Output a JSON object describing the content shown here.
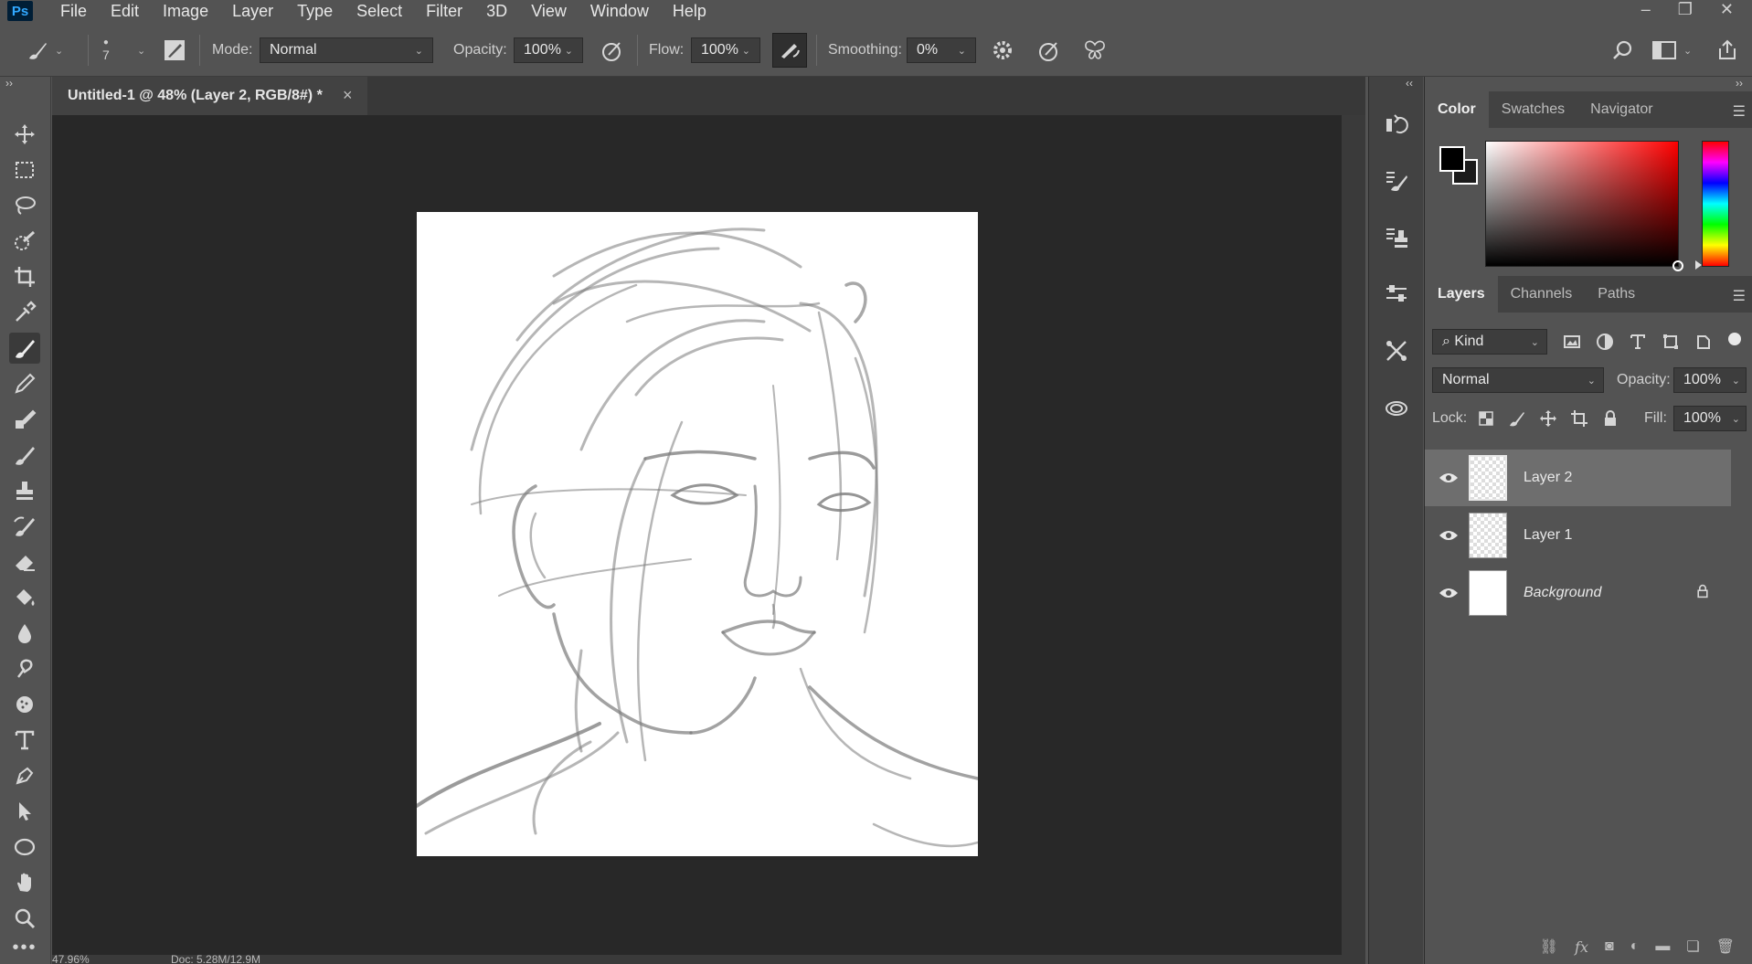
{
  "app": {
    "logo": "Ps"
  },
  "menu": [
    "File",
    "Edit",
    "Image",
    "Layer",
    "Type",
    "Select",
    "Filter",
    "3D",
    "View",
    "Window",
    "Help"
  ],
  "window_controls": {
    "minimize": "–",
    "restore": "❐",
    "close": "✕"
  },
  "options": {
    "brush_size": "7",
    "mode_label": "Mode:",
    "mode_value": "Normal",
    "opacity_label": "Opacity:",
    "opacity_value": "100%",
    "flow_label": "Flow:",
    "flow_value": "100%",
    "smoothing_label": "Smoothing:",
    "smoothing_value": "0%"
  },
  "document": {
    "tab_title": "Untitled-1 @ 48% (Layer 2, RGB/8#) *",
    "close": "×",
    "status_zoom": "47.96%",
    "status_doc": "Doc: 5.28M/12.9M"
  },
  "color_panel": {
    "tabs": [
      "Color",
      "Swatches",
      "Navigator"
    ],
    "active_tab": "Color",
    "foreground": "#000000",
    "background": "#1b1b1b"
  },
  "layers_panel": {
    "tabs": [
      "Layers",
      "Channels",
      "Paths"
    ],
    "active_tab": "Layers",
    "filter_kind": "Kind",
    "blend_mode": "Normal",
    "opacity_label": "Opacity:",
    "opacity_value": "100%",
    "lock_label": "Lock:",
    "fill_label": "Fill:",
    "fill_value": "100%",
    "layers": [
      {
        "name": "Layer 2",
        "selected": true,
        "locked": false
      },
      {
        "name": "Layer 1",
        "selected": false,
        "locked": false
      },
      {
        "name": "Background",
        "selected": false,
        "locked": true
      }
    ],
    "footer_fx": "fx"
  },
  "colors": {
    "accent": "#31a8ff",
    "panel": "#535353",
    "canvas_bg": "#282828"
  }
}
